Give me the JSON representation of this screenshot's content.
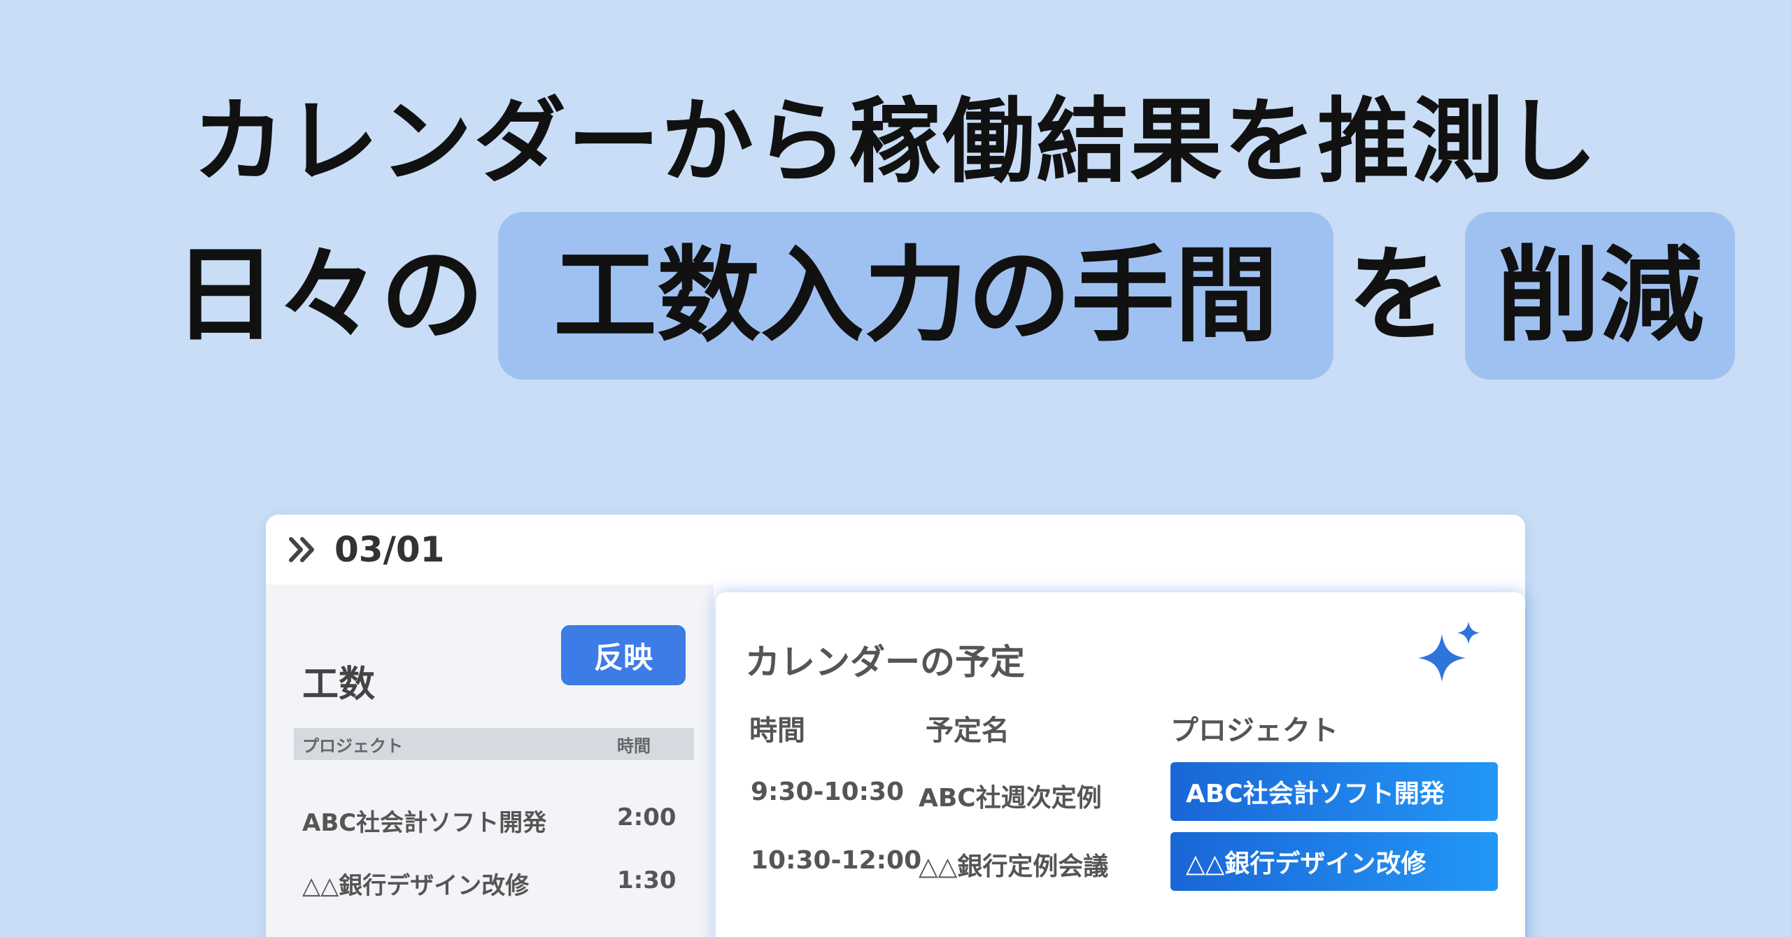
{
  "headline": {
    "line1": "カレンダーから稼働結果を推測し",
    "line2_prefix": "日々の",
    "line2_highlight1": "工数入力の手間",
    "line2_middle": "を",
    "line2_highlight2": "削減"
  },
  "window": {
    "date": "03/01",
    "chevron_icon": "double-chevron-right-icon"
  },
  "left_panel": {
    "title": "工数",
    "reflect_button": "反映",
    "columns": [
      "プロジェクト",
      "時間"
    ],
    "rows": [
      {
        "project": "ABC社会計ソフト開発",
        "time": "2:00"
      },
      {
        "project": "△△銀行デザイン改修",
        "time": "1:30"
      }
    ]
  },
  "calendar": {
    "title": "カレンダーの予定",
    "sparkle_icon": "sparkle-icon",
    "columns": [
      "時間",
      "予定名",
      "プロジェクト"
    ],
    "rows": [
      {
        "time": "9:30-10:30",
        "event": "ABC社週次定例",
        "project": "ABC社会計ソフト開発"
      },
      {
        "time": "10:30-12:00",
        "event": "△△銀行定例会議",
        "project": "△△銀行デザイン改修"
      }
    ]
  },
  "colors": {
    "background": "#c9ddf6",
    "highlight": "#9fc1f1",
    "accent": "#3d7be6",
    "chip": "#1a66d6"
  }
}
